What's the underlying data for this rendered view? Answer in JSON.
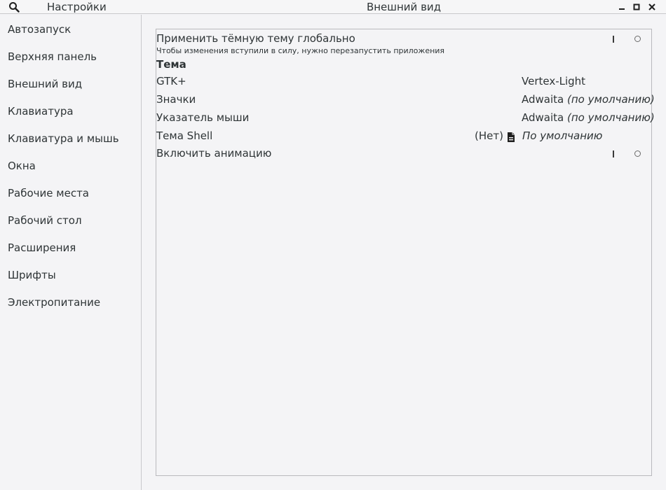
{
  "header": {
    "sidebar_title": "Настройки",
    "title": "Внешний вид"
  },
  "sidebar": {
    "items": [
      {
        "label": "Автозапуск"
      },
      {
        "label": "Верхняя панель"
      },
      {
        "label": "Внешний вид"
      },
      {
        "label": "Клавиатура"
      },
      {
        "label": "Клавиатура и мышь"
      },
      {
        "label": "Окна"
      },
      {
        "label": "Рабочие места"
      },
      {
        "label": "Рабочий стол"
      },
      {
        "label": "Расширения"
      },
      {
        "label": "Шрифты"
      },
      {
        "label": "Электропитание"
      }
    ]
  },
  "content": {
    "dark_theme": {
      "label": "Применить тёмную тему глобально",
      "hint": "Чтобы изменения вступили в силу, нужно перезапустить приложения",
      "enabled": false
    },
    "theme_section": "Тема",
    "gtk": {
      "label": "GTK+",
      "value": "Vertex-Light"
    },
    "icons": {
      "label": "Значки",
      "value": "Adwaita",
      "value_note": "(по умолчанию)"
    },
    "cursor": {
      "label": "Указатель мыши",
      "value": "Adwaita",
      "value_note": "(по умолчанию)"
    },
    "shell": {
      "label": "Тема Shell",
      "none_label": "(Нет)",
      "value": "По умолчанию"
    },
    "animations": {
      "label": "Включить анимацию",
      "enabled": false
    }
  },
  "icons": {
    "search": "search-icon",
    "minimize": "minimize-icon",
    "maximize": "maximize-icon",
    "close": "close-icon",
    "file": "file-icon"
  }
}
